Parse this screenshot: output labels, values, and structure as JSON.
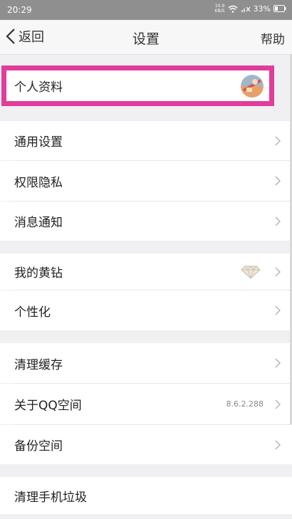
{
  "status_bar": {
    "time": "20:29",
    "speed_value": "10.9",
    "speed_unit": "KB/S",
    "battery": "33%",
    "icons": [
      "wifi-icon",
      "signal-icon",
      "battery-icon"
    ]
  },
  "nav": {
    "back_label": "返回",
    "title": "设置",
    "help_label": "帮助"
  },
  "profile": {
    "label": "个人资料",
    "avatar_icon": "avatar-icon",
    "highlight_color": "#e13c9b"
  },
  "group1": {
    "items": [
      {
        "label": "通用设置"
      },
      {
        "label": "权限隐私"
      },
      {
        "label": "消息通知"
      }
    ]
  },
  "group2": {
    "items": [
      {
        "label": "我的黄钻",
        "icon": "diamond-icon"
      },
      {
        "label": "个性化"
      }
    ]
  },
  "group3": {
    "items": [
      {
        "label": "清理缓存"
      },
      {
        "label": "关于QQ空间",
        "value": "8.6.2.288"
      },
      {
        "label": "备份空间"
      }
    ]
  },
  "group4": {
    "items": [
      {
        "label": "清理手机垃圾"
      }
    ]
  },
  "colors": {
    "background": "#f0f0f2",
    "row": "#ffffff",
    "status_bar": "#8f8f8f",
    "chevron": "#b5b5b5"
  }
}
